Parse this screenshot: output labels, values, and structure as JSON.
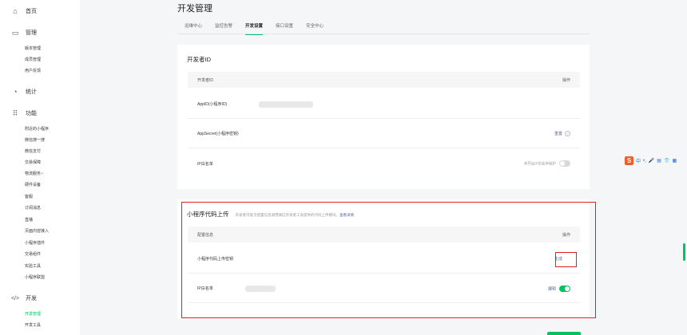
{
  "sidebar": {
    "home": "首页",
    "manage": {
      "title": "管理",
      "items": [
        "版本管理",
        "成员管理",
        "用户反馈"
      ]
    },
    "stats": "统计",
    "features": {
      "title": "功能",
      "items": [
        "附近的小程序",
        "微信搜一搜",
        "微信支付",
        "交易保障",
        "物流服务",
        "硬件设备",
        "客服",
        "订阅消息",
        "直播",
        "页面内容接入",
        "小程序插件",
        "交易组件",
        "实验工具",
        "小程序联盟"
      ],
      "badge_item_index": 4
    },
    "dev": {
      "title": "开发",
      "items": [
        "开发管理",
        "开发工具"
      ],
      "active_index": 0
    }
  },
  "page": {
    "title": "开发管理",
    "tabs": [
      "运维中心",
      "监控告警",
      "开发设置",
      "接口设置",
      "安全中心"
    ],
    "active_tab": 2
  },
  "developer_card": {
    "title": "开发者ID",
    "head_left": "开发者ID",
    "head_right": "操作",
    "rows": [
      {
        "label": "AppID(小程序ID)",
        "action": ""
      },
      {
        "label": "AppSecret(小程序密钥)",
        "action": "重置"
      },
      {
        "label": "IP白名单",
        "action": "未开启IP白名单保护"
      }
    ]
  },
  "upload_card": {
    "title": "小程序代码上传",
    "desc": "开发者可基于配置信息调用微信开发者工具提供的代码上传模块。",
    "desc_link": "查看详情",
    "head_left": "配置信息",
    "head_right": "操作",
    "rows": [
      {
        "label": "小程序代码上传密钥",
        "action": "生成"
      },
      {
        "label": "IP白名单",
        "action": "编辑"
      }
    ]
  },
  "ime": {
    "items": [
      "中",
      "•,",
      "🎤",
      "▤",
      "👕",
      "▦"
    ]
  }
}
